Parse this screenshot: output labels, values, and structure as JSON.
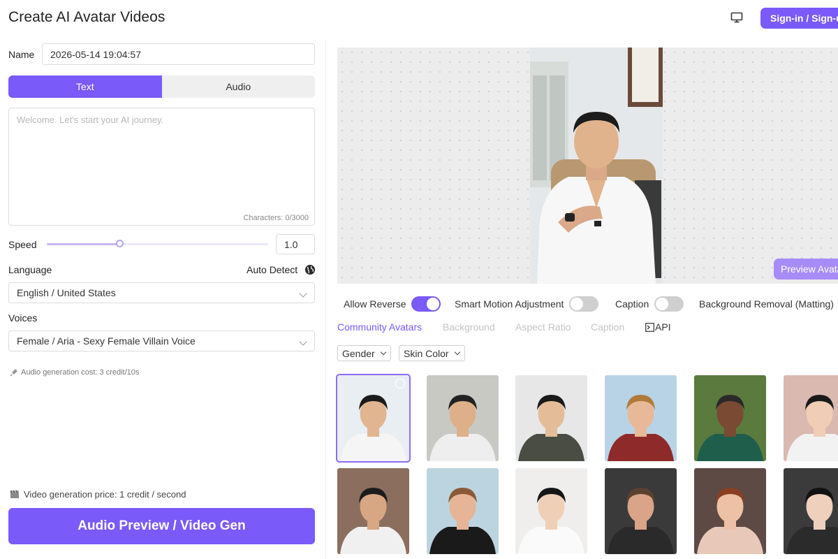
{
  "header": {
    "title": "Create AI Avatar Videos",
    "signin_label": "Sign-in / Sign-up",
    "monitor_icon": "monitor-icon"
  },
  "form": {
    "name_label": "Name",
    "name_value": "2026-05-14 19:04:57",
    "tabs": [
      {
        "label": "Text",
        "active": true
      },
      {
        "label": "Audio",
        "active": false
      }
    ],
    "text_placeholder": "Welcome. Let's start your AI journey.",
    "char_count": "Characters: 0/3000",
    "speed_label": "Speed",
    "speed_value": "1.0",
    "speed_fraction": 0.33,
    "language_label": "Language",
    "auto_detect_label": "Auto Detect",
    "language_value": "English / United States",
    "voices_label": "Voices",
    "voice_value": "Female / Aria - Sexy Female Villain Voice",
    "audio_cost": "Audio generation cost: 3 credit/10s",
    "video_price": "Video generation price: 1 credit / second",
    "generate_label": "Audio Preview / Video Gen"
  },
  "preview": {
    "preview_button": "Preview Avatar"
  },
  "options": {
    "toggles": [
      {
        "label": "Allow Reverse",
        "on": true
      },
      {
        "label": "Smart Motion Adjustment",
        "on": false
      },
      {
        "label": "Caption",
        "on": false
      },
      {
        "label": "Background Removal (Matting)",
        "on": false
      }
    ]
  },
  "subtabs": [
    {
      "label": "Community Avatars",
      "active": true
    },
    {
      "label": "Background",
      "active": false
    },
    {
      "label": "Aspect Ratio",
      "active": false
    },
    {
      "label": "Caption",
      "active": false
    },
    {
      "label": "API",
      "active": false
    }
  ],
  "filters": [
    {
      "label": "Gender"
    },
    {
      "label": "Skin Color"
    }
  ],
  "colors": {
    "accent": "#7a5af8",
    "accent_light": "#a78cf7"
  },
  "avatars": [
    {
      "bg": "#e9eef2",
      "skin": "#e0b58f",
      "hair": "#1b1b1b",
      "shirt": "#f5f5f5",
      "selected": true
    },
    {
      "bg": "#c9c9c4",
      "skin": "#ddb08a",
      "hair": "#222222",
      "shirt": "#eeeeee",
      "selected": false
    },
    {
      "bg": "#e7e7e7",
      "skin": "#e4bd98",
      "hair": "#1a1a1a",
      "shirt": "#4a4d43",
      "selected": false
    },
    {
      "bg": "#b9d3e6",
      "skin": "#e8b998",
      "hair": "#b07a3a",
      "shirt": "#8e2a2a",
      "selected": false
    },
    {
      "bg": "#5b7a3d",
      "skin": "#7a4a33",
      "hair": "#2a2a2a",
      "shirt": "#1f5e4a",
      "selected": false
    },
    {
      "bg": "#d9b9b0",
      "skin": "#f0cdb5",
      "hair": "#1a1a1a",
      "shirt": "#f2f2f2",
      "selected": false
    },
    {
      "bg": "#8b6e5e",
      "skin": "#d7a683",
      "hair": "#1c1c1c",
      "shirt": "#f0f0f0",
      "selected": false
    },
    {
      "bg": "#bcd4df",
      "skin": "#e6b496",
      "hair": "#8a5a38",
      "shirt": "#1a1a1a",
      "selected": false
    },
    {
      "bg": "#efeeec",
      "skin": "#efcfb6",
      "hair": "#161616",
      "shirt": "#fafafa",
      "selected": false
    },
    {
      "bg": "#3a3a3a",
      "skin": "#d9a488",
      "hair": "#5a4230",
      "shirt": "#2a2a2a",
      "selected": false
    },
    {
      "bg": "#5e4a44",
      "skin": "#edc1a6",
      "hair": "#8a3f22",
      "shirt": "#e8c9b9",
      "selected": false
    },
    {
      "bg": "#3b3b3b",
      "skin": "#efd0bd",
      "hair": "#121212",
      "shirt": "#2b2b2b",
      "selected": false
    }
  ]
}
